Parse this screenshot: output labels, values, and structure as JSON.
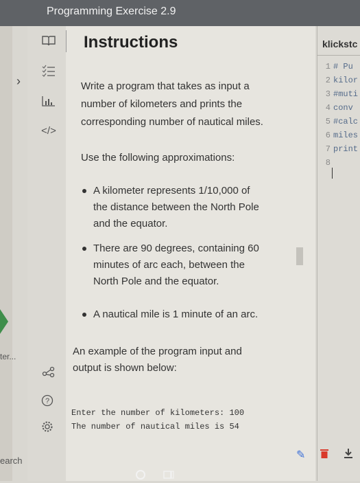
{
  "window": {
    "title": "Programming Exercise 2.9"
  },
  "left_edge": {
    "partial_label": "ter...",
    "search_partial": "earch"
  },
  "instructions": {
    "heading": "Instructions",
    "prompt_lines": [
      "Write a program that takes as input a",
      "number of kilometers and prints the",
      "corresponding number of nautical miles."
    ],
    "use_following": "Use the following approximations:",
    "bullets": [
      [
        "A kilometer represents 1/10,000 of",
        "the distance between the North Pole",
        "and the equator."
      ],
      [
        "There are 90 degrees, containing 60",
        "minutes of arc each, between the",
        "North Pole and the equator."
      ],
      [
        "A nautical mile is 1 minute of an arc."
      ]
    ],
    "example_lines": [
      "An example of the program input and",
      "output is shown below:"
    ],
    "sample_output": [
      "Enter the number of kilometers: 100",
      "The number of nautical miles is 54"
    ]
  },
  "editor": {
    "tab_label": "klickstc",
    "lines": [
      {
        "num": "1",
        "text": "# Pu"
      },
      {
        "num": "2",
        "text": "kilor"
      },
      {
        "num": "3",
        "text": "#muti"
      },
      {
        "num": "4",
        "text": "conv"
      },
      {
        "num": "5",
        "text": "#calc"
      },
      {
        "num": "6",
        "text": "miles"
      },
      {
        "num": "7",
        "text": "print"
      },
      {
        "num": "8",
        "text": ""
      }
    ]
  },
  "colors": {
    "accent_green": "#3f8e4b",
    "accent_blue": "#3b6fd8",
    "trash_red": "#d93a2b"
  }
}
